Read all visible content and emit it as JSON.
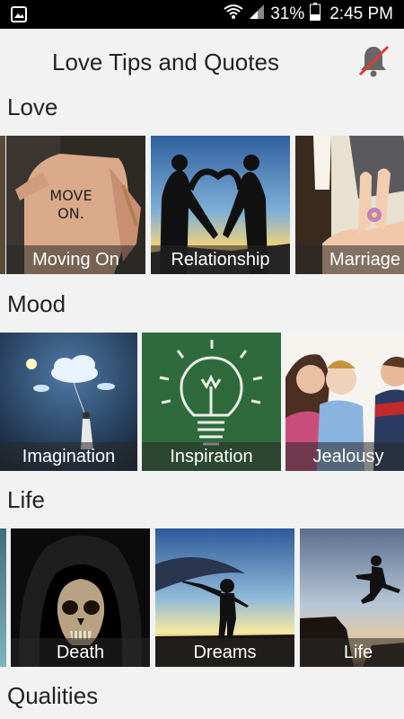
{
  "status_bar": {
    "battery_percent": "31%",
    "time": "2:45 PM",
    "icons": [
      "image-icon",
      "wifi-icon",
      "signal-icon",
      "battery-icon"
    ]
  },
  "app_bar": {
    "title": "Love Tips and Quotes",
    "notification_icon": "bell-muted-icon"
  },
  "sections": [
    {
      "title": "Love",
      "tiles": [
        "Moving On",
        "Relationship",
        "Marriage"
      ]
    },
    {
      "title": "Mood",
      "tiles": [
        "Imagination",
        "Inspiration",
        "Jealousy"
      ]
    },
    {
      "title": "Life",
      "tiles": [
        "Death",
        "Dreams",
        "Life"
      ]
    },
    {
      "title": "Qualities",
      "tiles": []
    }
  ],
  "colors": {
    "background": "#f2f2f2",
    "status_bar": "#000000",
    "mute_slash": "#e53935"
  }
}
